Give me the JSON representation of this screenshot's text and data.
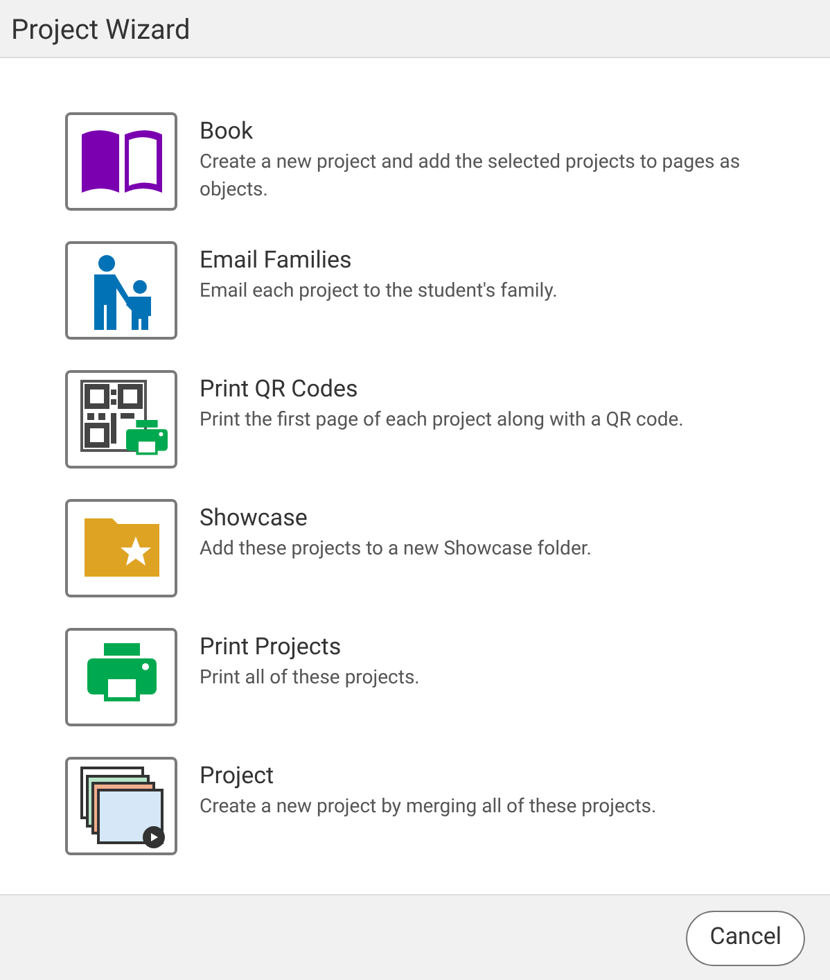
{
  "window": {
    "title": "Project Wizard"
  },
  "options": [
    {
      "kind": "book",
      "title": "Book",
      "description": "Create a new project and add the selected projects to pages as objects."
    },
    {
      "kind": "family",
      "title": "Email Families",
      "description": "Email each project to the student's family."
    },
    {
      "kind": "qr",
      "title": "Print QR Codes",
      "description": "Print the first page of each project along with a QR code."
    },
    {
      "kind": "showcase",
      "title": "Showcase",
      "description": "Add these projects to a new Showcase folder."
    },
    {
      "kind": "print",
      "title": "Print Projects",
      "description": "Print all of these projects."
    },
    {
      "kind": "project",
      "title": "Project",
      "description": "Create a new project by merging all of these projects."
    }
  ],
  "buttons": [
    {
      "label": "Cancel"
    }
  ]
}
